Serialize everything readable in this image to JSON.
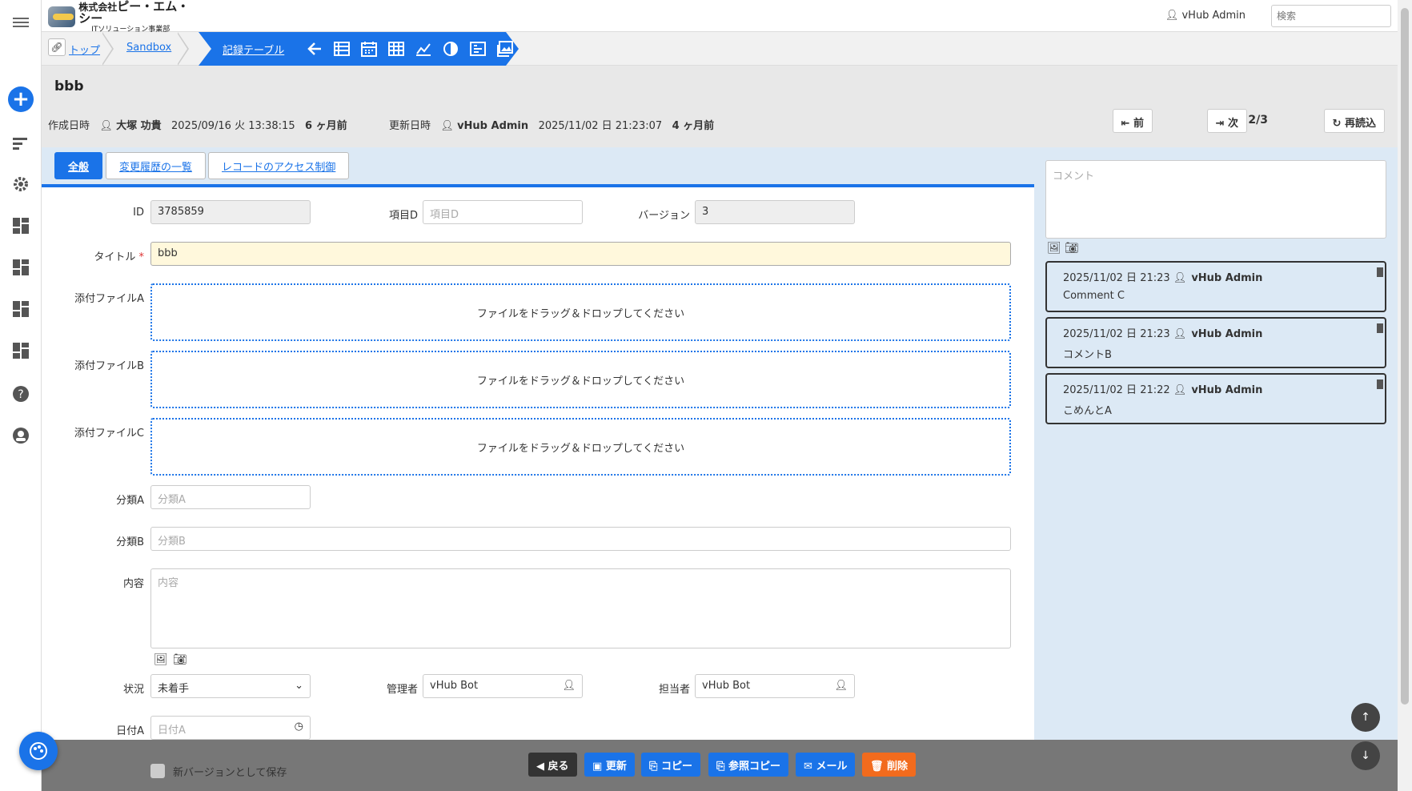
{
  "header": {
    "company_prefix": "株式会社",
    "company_name": "ピー・エム・シー",
    "company_sub": "ITソリューション事業部",
    "user_name": "vHub Admin",
    "search_placeholder": "検索"
  },
  "breadcrumb": {
    "items": [
      "トップ",
      "Sandbox",
      "記録テーブル"
    ]
  },
  "record": {
    "title": "bbb",
    "created_label": "作成日時",
    "created_by": "大塚 功貴",
    "created_at": "2025/09/16 火 13:38:15",
    "created_ago": "6 ヶ月前",
    "updated_label": "更新日時",
    "updated_by": "vHub Admin",
    "updated_at": "2025/11/02 日 21:23:07",
    "updated_ago": "4 ヶ月前",
    "prev_label": "前",
    "page": "2/3",
    "next_label": "次",
    "reload_label": "再読込"
  },
  "tabs": [
    "全般",
    "変更履歴の一覧",
    "レコードのアクセス制御"
  ],
  "form": {
    "id_label": "ID",
    "id_value": "3785859",
    "itemd_label": "項目D",
    "itemd_placeholder": "項目D",
    "version_label": "バージョン",
    "version_value": "3",
    "title_label": "タイトル",
    "title_required": "*",
    "title_value": "bbb",
    "fileA_label": "添付ファイルA",
    "fileB_label": "添付ファイルB",
    "fileC_label": "添付ファイルC",
    "drop_text": "ファイルをドラッグ＆ドロップしてください",
    "classA_label": "分類A",
    "classA_placeholder": "分類A",
    "classB_label": "分類B",
    "classB_placeholder": "分類B",
    "content_label": "内容",
    "content_placeholder": "内容",
    "status_label": "状況",
    "status_value": "未着手",
    "manager_label": "管理者",
    "manager_value": "vHub Bot",
    "owner_label": "担当者",
    "owner_value": "vHub Bot",
    "dateA_label": "日付A",
    "dateA_placeholder": "日付A"
  },
  "comments": {
    "placeholder": "コメント",
    "items": [
      {
        "time": "2025/11/02 日 21:23",
        "user": "vHub Admin",
        "body": "Comment C"
      },
      {
        "time": "2025/11/02 日 21:23",
        "user": "vHub Admin",
        "body": "コメントB"
      },
      {
        "time": "2025/11/02 日 21:22",
        "user": "vHub Admin",
        "body": "こめんとA"
      }
    ]
  },
  "actions": {
    "new_version_label": "新バージョンとして保存",
    "back": "戻る",
    "update": "更新",
    "copy": "コピー",
    "ref_copy": "参照コピー",
    "mail": "メール",
    "delete": "削除"
  },
  "colors": {
    "accent": "#1a73e8",
    "danger": "#f26b1d",
    "sidebar_bg": "#dce9f5"
  }
}
